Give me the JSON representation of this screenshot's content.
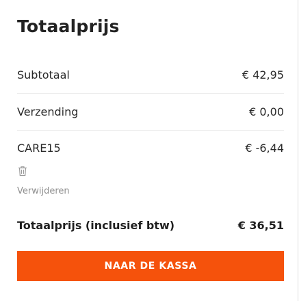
{
  "cart_summary": {
    "title": "Totaalprijs",
    "rows": [
      {
        "label": "Subtotaal",
        "amount": "€ 42,95"
      },
      {
        "label": "Verzending",
        "amount": "€ 0,00"
      },
      {
        "label": "CARE15",
        "amount": "€ -6,44"
      }
    ],
    "coupon": {
      "remove_icon": "trash-icon",
      "remove_label": "Verwijderen"
    },
    "total": {
      "label": "Totaalprijs (inclusief btw)",
      "amount": "€ 36,51"
    },
    "checkout_label": "NAAR DE KASSA",
    "colors": {
      "accent": "#f5520c",
      "text": "#1f1f1f",
      "muted": "#8f8f8f",
      "divider": "#ececec"
    }
  }
}
